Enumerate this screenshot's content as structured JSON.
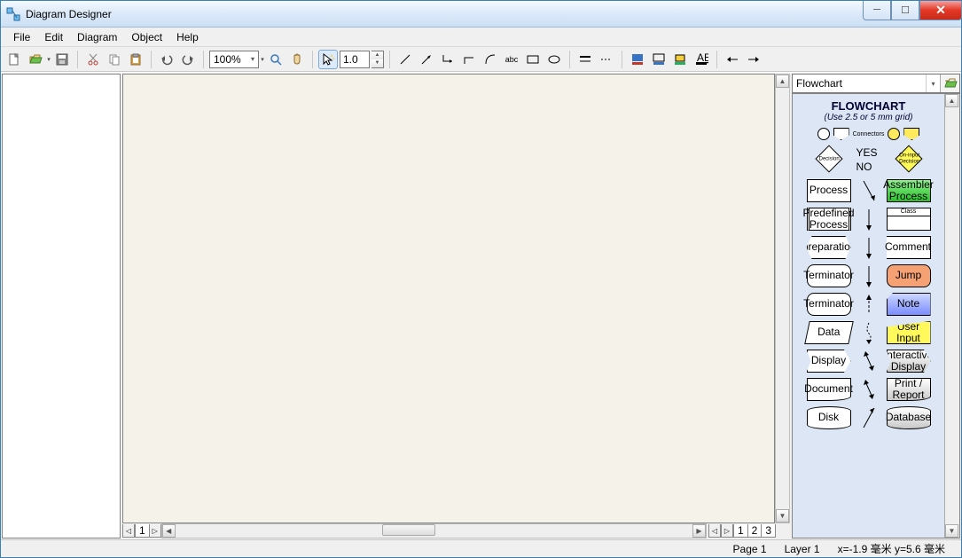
{
  "window": {
    "title": "Diagram Designer"
  },
  "menu": {
    "file": "File",
    "edit": "Edit",
    "diagram": "Diagram",
    "object": "Object",
    "help": "Help"
  },
  "toolbar": {
    "zoom": "100%",
    "lineweight": "1.0"
  },
  "palette": {
    "selector": "Flowchart",
    "title": "FLOWCHART",
    "subtitle": "(Use 2.5 or 5 mm grid)",
    "connectors_label": "Connectors",
    "decision": "Decision",
    "yes": "YES",
    "no": "NO",
    "oninput": "On-input Decision",
    "process": "Process",
    "assembler": "Assembler Process",
    "predefined": "Predefined Process",
    "class": "Class",
    "preparation": "Preparation",
    "comment": "Comment",
    "terminator": "Terminator",
    "jump": "Jump",
    "terminator2": "Terminator",
    "note": "Note",
    "data": "Data",
    "userinput": "User Input",
    "display": "Display",
    "interactive": "Interactive Display",
    "document": "Document",
    "printreport": "Print / Report",
    "disk": "Disk",
    "database": "Database"
  },
  "tabs": [
    "1",
    "2",
    "3"
  ],
  "status": {
    "page": "Page 1",
    "layer": "Layer 1",
    "coords": "x=-1.9 毫米  y=5.6 毫米"
  }
}
